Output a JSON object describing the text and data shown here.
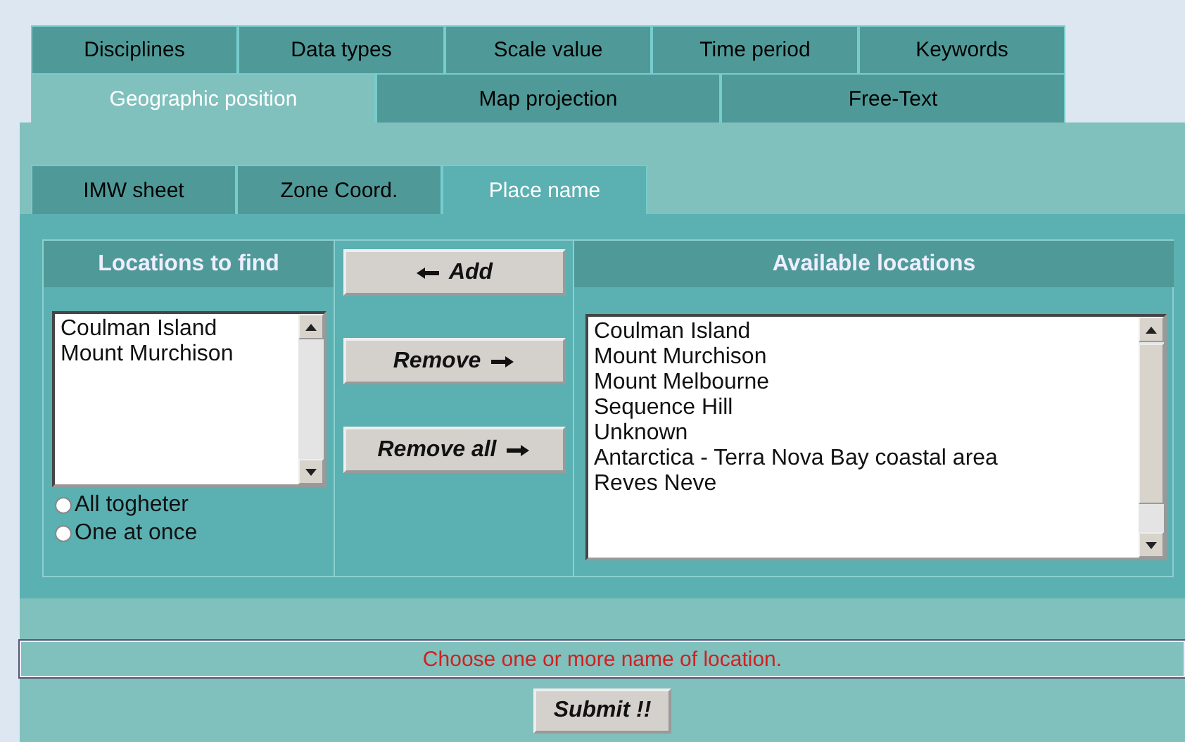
{
  "main_tabs_row_1": [
    {
      "label": "Disciplines",
      "selected": false
    },
    {
      "label": "Data types",
      "selected": false
    },
    {
      "label": "Scale value",
      "selected": false
    },
    {
      "label": "Time period",
      "selected": false
    },
    {
      "label": "Keywords",
      "selected": false
    }
  ],
  "main_tabs_row_2": [
    {
      "label": "Geographic position",
      "selected": true
    },
    {
      "label": "Map projection",
      "selected": false
    },
    {
      "label": "Free-Text",
      "selected": false
    }
  ],
  "sub_tabs": [
    {
      "label": "IMW sheet",
      "selected": false
    },
    {
      "label": "Zone Coord.",
      "selected": false
    },
    {
      "label": "Place name",
      "selected": true
    }
  ],
  "locations_to_find": {
    "title": "Locations to find",
    "items": [
      "Coulman Island",
      "Mount Murchison"
    ],
    "options": [
      {
        "label": "All togheter",
        "selected": false
      },
      {
        "label": "One at once",
        "selected": false
      }
    ]
  },
  "buttons": [
    {
      "label": "Add",
      "kind": "add"
    },
    {
      "label": "Remove",
      "kind": "remove"
    },
    {
      "label": "Remove all",
      "kind": "remove"
    }
  ],
  "available_locations": {
    "title": "Available locations",
    "items": [
      "Coulman Island",
      "Mount Murchison",
      "Mount Melbourne",
      "Sequence Hill",
      "Unknown",
      "Antarctica - Terra Nova Bay coastal area",
      "Reves Neve"
    ]
  },
  "message": "Choose one or more name of location.",
  "submit": "Submit !!"
}
